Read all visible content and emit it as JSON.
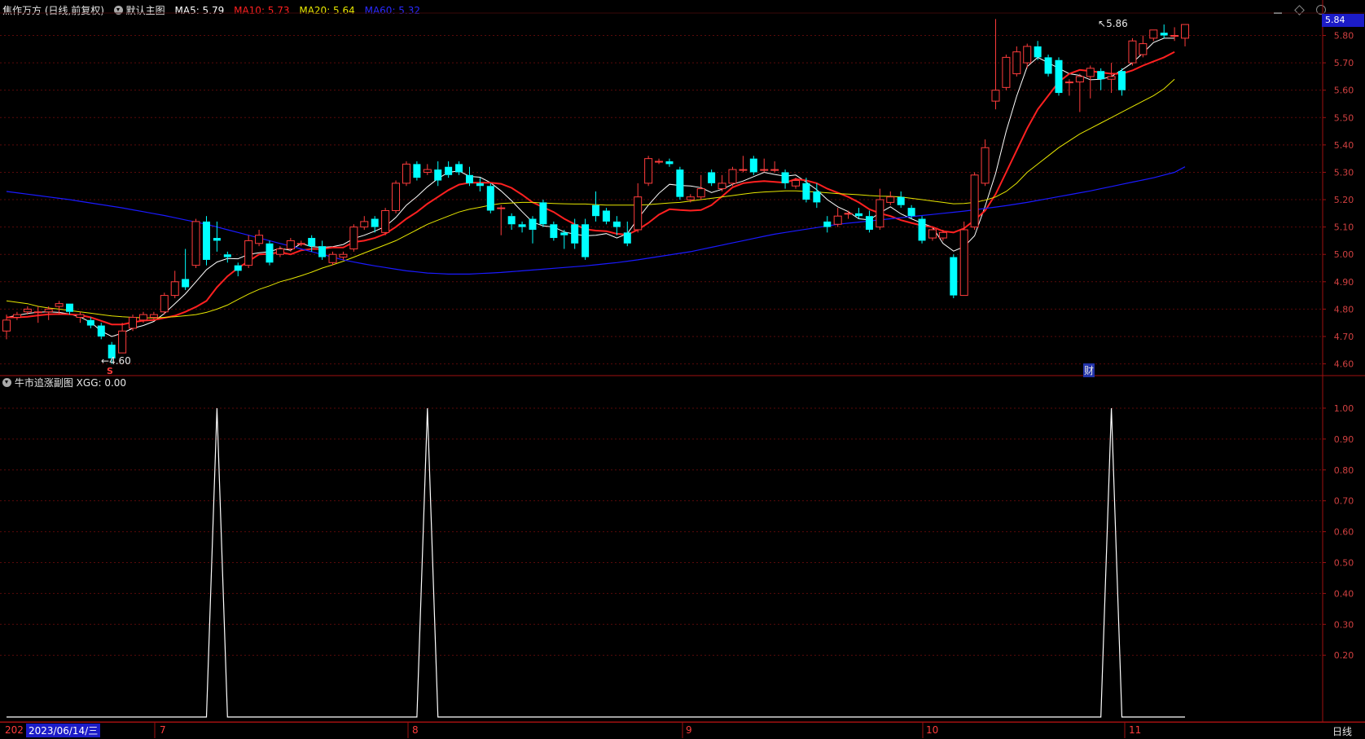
{
  "header": {
    "stock_title": "焦作万方 (日线,前复权)",
    "indicator_name": "默认主图",
    "ma5": "MA5: 5.79",
    "ma10": "MA10: 5.73",
    "ma20": "MA20: 5.64",
    "ma60": "MA60: 5.32"
  },
  "sub_header": {
    "indicator_name": "牛市追涨副图",
    "value": "XGG: 0.00"
  },
  "colors": {
    "up": "#ff3c3c",
    "down": "#00ffff",
    "ma5": "#ffffff",
    "ma10": "#ff2020",
    "ma20": "#e6e600",
    "ma60": "#1a1aff",
    "axis": "#a01010",
    "price_tag_bg": "#1c1cc8"
  },
  "current_price_tag": "5.84",
  "annotations": {
    "high_label": "5.86",
    "low_label": "4.60",
    "s_marker": "S",
    "cai_marker": "财"
  },
  "bottom_bar": {
    "year_clip": "202",
    "date_label": "2023/06/14/三",
    "months": [
      "7",
      "8",
      "9",
      "10",
      "11"
    ],
    "period_button": "日线"
  },
  "chart_data": [
    {
      "type": "candlestick",
      "ylim": [
        4.56,
        5.87
      ],
      "y_ticks": [
        "5.80",
        "5.70",
        "5.60",
        "5.50",
        "5.40",
        "5.30",
        "5.20",
        "5.10",
        "5.00",
        "4.90",
        "4.80",
        "4.70",
        "4.60"
      ],
      "candles": [
        [
          4.72,
          4.76,
          4.69,
          4.78
        ],
        [
          4.77,
          4.78,
          4.76,
          4.79
        ],
        [
          4.79,
          4.8,
          4.78,
          4.81
        ],
        [
          4.79,
          4.79,
          4.75,
          4.81
        ],
        [
          4.79,
          4.8,
          4.76,
          4.81
        ],
        [
          4.81,
          4.82,
          4.78,
          4.83
        ],
        [
          4.82,
          4.79,
          4.78,
          4.82
        ],
        [
          4.77,
          4.78,
          4.75,
          4.79
        ],
        [
          4.76,
          4.74,
          4.73,
          4.77
        ],
        [
          4.74,
          4.7,
          4.69,
          4.75
        ],
        [
          4.67,
          4.62,
          4.6,
          4.68
        ],
        [
          4.64,
          4.72,
          4.64,
          4.75
        ],
        [
          4.73,
          4.77,
          4.72,
          4.78
        ],
        [
          4.76,
          4.78,
          4.75,
          4.79
        ],
        [
          4.77,
          4.78,
          4.76,
          4.79
        ],
        [
          4.79,
          4.85,
          4.78,
          4.86
        ],
        [
          4.85,
          4.9,
          4.84,
          4.94
        ],
        [
          4.91,
          4.88,
          4.87,
          5.02
        ],
        [
          4.96,
          5.12,
          4.95,
          5.13
        ],
        [
          5.12,
          4.98,
          4.96,
          5.14
        ],
        [
          5.06,
          5.05,
          5.01,
          5.12
        ],
        [
          5.0,
          4.99,
          4.97,
          5.01
        ],
        [
          4.96,
          4.94,
          4.92,
          4.97
        ],
        [
          4.96,
          5.05,
          4.95,
          5.07
        ],
        [
          5.04,
          5.07,
          5.03,
          5.09
        ],
        [
          5.04,
          4.97,
          4.96,
          5.05
        ],
        [
          5.0,
          5.02,
          4.99,
          5.03
        ],
        [
          5.02,
          5.05,
          5.01,
          5.06
        ],
        [
          5.04,
          5.04,
          5.03,
          5.05
        ],
        [
          5.06,
          5.03,
          5.01,
          5.07
        ],
        [
          5.03,
          4.99,
          4.98,
          5.05
        ],
        [
          4.97,
          5.0,
          4.96,
          5.01
        ],
        [
          4.99,
          5.0,
          4.98,
          5.01
        ],
        [
          5.02,
          5.1,
          5.01,
          5.11
        ],
        [
          5.1,
          5.12,
          5.09,
          5.14
        ],
        [
          5.13,
          5.1,
          5.08,
          5.14
        ],
        [
          5.08,
          5.16,
          5.07,
          5.17
        ],
        [
          5.16,
          5.26,
          5.15,
          5.27
        ],
        [
          5.26,
          5.33,
          5.25,
          5.34
        ],
        [
          5.33,
          5.28,
          5.27,
          5.34
        ],
        [
          5.3,
          5.31,
          5.29,
          5.33
        ],
        [
          5.31,
          5.27,
          5.25,
          5.34
        ],
        [
          5.32,
          5.29,
          5.28,
          5.34
        ],
        [
          5.33,
          5.3,
          5.29,
          5.34
        ],
        [
          5.29,
          5.26,
          5.25,
          5.32
        ],
        [
          5.26,
          5.25,
          5.23,
          5.28
        ],
        [
          5.25,
          5.16,
          5.15,
          5.26
        ],
        [
          5.17,
          5.17,
          5.07,
          5.18
        ],
        [
          5.14,
          5.11,
          5.09,
          5.15
        ],
        [
          5.11,
          5.1,
          5.08,
          5.12
        ],
        [
          5.13,
          5.09,
          5.04,
          5.14
        ],
        [
          5.19,
          5.11,
          5.1,
          5.2
        ],
        [
          5.11,
          5.06,
          5.05,
          5.12
        ],
        [
          5.08,
          5.07,
          5.02,
          5.09
        ],
        [
          5.11,
          5.04,
          5.02,
          5.13
        ],
        [
          5.11,
          4.99,
          4.98,
          5.13
        ],
        [
          5.18,
          5.14,
          5.12,
          5.23
        ],
        [
          5.16,
          5.12,
          5.11,
          5.17
        ],
        [
          5.12,
          5.1,
          5.07,
          5.14
        ],
        [
          5.08,
          5.04,
          5.03,
          5.12
        ],
        [
          5.09,
          5.21,
          5.08,
          5.26
        ],
        [
          5.26,
          5.35,
          5.25,
          5.36
        ],
        [
          5.34,
          5.34,
          5.33,
          5.35
        ],
        [
          5.34,
          5.33,
          5.32,
          5.35
        ],
        [
          5.31,
          5.21,
          5.2,
          5.32
        ],
        [
          5.2,
          5.21,
          5.19,
          5.22
        ],
        [
          5.21,
          5.24,
          5.2,
          5.29
        ],
        [
          5.3,
          5.26,
          5.25,
          5.31
        ],
        [
          5.24,
          5.26,
          5.23,
          5.29
        ],
        [
          5.26,
          5.31,
          5.25,
          5.32
        ],
        [
          5.31,
          5.31,
          5.3,
          5.36
        ],
        [
          5.35,
          5.3,
          5.29,
          5.36
        ],
        [
          5.31,
          5.31,
          5.3,
          5.35
        ],
        [
          5.31,
          5.31,
          5.3,
          5.34
        ],
        [
          5.3,
          5.26,
          5.24,
          5.31
        ],
        [
          5.25,
          5.27,
          5.24,
          5.28
        ],
        [
          5.26,
          5.2,
          5.19,
          5.28
        ],
        [
          5.23,
          5.19,
          5.17,
          5.26
        ],
        [
          5.12,
          5.1,
          5.08,
          5.14
        ],
        [
          5.11,
          5.14,
          5.1,
          5.17
        ],
        [
          5.15,
          5.15,
          5.13,
          5.16
        ],
        [
          5.15,
          5.14,
          5.13,
          5.17
        ],
        [
          5.14,
          5.09,
          5.08,
          5.16
        ],
        [
          5.1,
          5.2,
          5.09,
          5.24
        ],
        [
          5.19,
          5.21,
          5.18,
          5.23
        ],
        [
          5.21,
          5.18,
          5.17,
          5.23
        ],
        [
          5.17,
          5.14,
          5.13,
          5.18
        ],
        [
          5.13,
          5.05,
          5.04,
          5.14
        ],
        [
          5.06,
          5.09,
          5.05,
          5.1
        ],
        [
          5.06,
          5.08,
          5.05,
          5.09
        ],
        [
          4.99,
          4.85,
          4.84,
          5.0
        ],
        [
          4.85,
          5.09,
          4.85,
          5.12
        ],
        [
          5.1,
          5.29,
          5.09,
          5.3
        ],
        [
          5.26,
          5.39,
          5.25,
          5.42
        ],
        [
          5.56,
          5.6,
          5.53,
          5.86
        ],
        [
          5.61,
          5.72,
          5.6,
          5.73
        ],
        [
          5.66,
          5.74,
          5.65,
          5.76
        ],
        [
          5.7,
          5.76,
          5.68,
          5.77
        ],
        [
          5.76,
          5.72,
          5.71,
          5.78
        ],
        [
          5.72,
          5.66,
          5.65,
          5.73
        ],
        [
          5.71,
          5.59,
          5.58,
          5.72
        ],
        [
          5.63,
          5.63,
          5.58,
          5.64
        ],
        [
          5.63,
          5.65,
          5.52,
          5.66
        ],
        [
          5.65,
          5.68,
          5.57,
          5.69
        ],
        [
          5.67,
          5.64,
          5.6,
          5.68
        ],
        [
          5.64,
          5.65,
          5.59,
          5.7
        ],
        [
          5.67,
          5.6,
          5.58,
          5.68
        ],
        [
          5.7,
          5.78,
          5.69,
          5.79
        ],
        [
          5.73,
          5.77,
          5.72,
          5.8
        ],
        [
          5.79,
          5.82,
          5.78,
          5.82
        ],
        [
          5.81,
          5.8,
          5.79,
          5.84
        ],
        [
          5.8,
          5.8,
          5.78,
          5.83
        ],
        [
          5.79,
          5.84,
          5.76,
          5.84
        ]
      ],
      "ma_series": [
        {
          "name": "MA5",
          "values": [
            4.77,
            4.777,
            4.784,
            4.789,
            4.79,
            4.788,
            4.782,
            4.771,
            4.752,
            4.72,
            4.7,
            4.712,
            4.73,
            4.74,
            4.755,
            4.784,
            4.82,
            4.856,
            4.9,
            4.944,
            4.972,
            4.985,
            4.984,
            5.0,
            5.006,
            5.01,
            5.022,
            5.015,
            5.04,
            5.028,
            5.026,
            5.028,
            5.036,
            5.058,
            5.07,
            5.085,
            5.102,
            5.135,
            5.18,
            5.211,
            5.247,
            5.277,
            5.3,
            5.305,
            5.285,
            5.282,
            5.262,
            5.232,
            5.196,
            5.156,
            5.118,
            5.104,
            5.1,
            5.082,
            5.074,
            5.068,
            5.07,
            5.076,
            5.06,
            5.076,
            5.13,
            5.18,
            5.223,
            5.256,
            5.252,
            5.25,
            5.244,
            5.226,
            5.238,
            5.256,
            5.268,
            5.284,
            5.3,
            5.292,
            5.286,
            5.29,
            5.264,
            5.236,
            5.2,
            5.174,
            5.156,
            5.13,
            5.126,
            5.152,
            5.174,
            5.148,
            5.13,
            5.114,
            5.1,
            5.04,
            5.012,
            5.028,
            5.068,
            5.176,
            5.296,
            5.45,
            5.578,
            5.686,
            5.72,
            5.7,
            5.68,
            5.66,
            5.654,
            5.638,
            5.64,
            5.65,
            5.674,
            5.7,
            5.736,
            5.774,
            5.79,
            5.79
          ]
        },
        {
          "name": "MA10",
          "values": [
            4.77,
            4.77,
            4.772,
            4.777,
            4.781,
            4.782,
            4.781,
            4.778,
            4.77,
            4.757,
            4.744,
            4.744,
            4.752,
            4.758,
            4.76,
            4.768,
            4.776,
            4.79,
            4.808,
            4.83,
            4.88,
            4.92,
            4.95,
            4.975,
            5.0,
            5.002,
            5.008,
            5.0,
            5.015,
            5.02,
            5.02,
            5.025,
            5.025,
            5.045,
            5.05,
            5.06,
            5.075,
            5.1,
            5.13,
            5.155,
            5.185,
            5.21,
            5.235,
            5.255,
            5.262,
            5.262,
            5.262,
            5.258,
            5.243,
            5.218,
            5.19,
            5.172,
            5.155,
            5.13,
            5.11,
            5.092,
            5.087,
            5.085,
            5.075,
            5.072,
            5.09,
            5.115,
            5.145,
            5.165,
            5.162,
            5.16,
            5.162,
            5.18,
            5.212,
            5.245,
            5.26,
            5.265,
            5.268,
            5.265,
            5.262,
            5.275,
            5.27,
            5.26,
            5.24,
            5.225,
            5.21,
            5.19,
            5.165,
            5.15,
            5.14,
            5.125,
            5.115,
            5.105,
            5.1,
            5.085,
            5.08,
            5.095,
            5.125,
            5.16,
            5.22,
            5.3,
            5.38,
            5.46,
            5.53,
            5.58,
            5.63,
            5.66,
            5.674,
            5.67,
            5.665,
            5.66,
            5.66,
            5.672,
            5.69,
            5.705,
            5.72,
            5.74
          ]
        },
        {
          "name": "MA20",
          "values": [
            4.83,
            4.825,
            4.82,
            4.81,
            4.804,
            4.8,
            4.795,
            4.79,
            4.785,
            4.78,
            4.775,
            4.772,
            4.77,
            4.768,
            4.768,
            4.77,
            4.772,
            4.776,
            4.78,
            4.788,
            4.8,
            4.815,
            4.835,
            4.855,
            4.872,
            4.885,
            4.9,
            4.91,
            4.922,
            4.935,
            4.95,
            4.962,
            4.975,
            4.99,
            5.005,
            5.02,
            5.035,
            5.05,
            5.07,
            5.09,
            5.11,
            5.125,
            5.14,
            5.155,
            5.165,
            5.172,
            5.18,
            5.186,
            5.188,
            5.19,
            5.19,
            5.188,
            5.186,
            5.185,
            5.184,
            5.184,
            5.182,
            5.18,
            5.18,
            5.18,
            5.18,
            5.182,
            5.185,
            5.188,
            5.19,
            5.195,
            5.2,
            5.205,
            5.21,
            5.215,
            5.22,
            5.225,
            5.228,
            5.23,
            5.232,
            5.232,
            5.23,
            5.228,
            5.225,
            5.222,
            5.22,
            5.218,
            5.215,
            5.213,
            5.212,
            5.21,
            5.205,
            5.2,
            5.195,
            5.19,
            5.185,
            5.186,
            5.19,
            5.198,
            5.21,
            5.23,
            5.26,
            5.3,
            5.33,
            5.36,
            5.39,
            5.415,
            5.44,
            5.46,
            5.48,
            5.5,
            5.52,
            5.54,
            5.56,
            5.58,
            5.605,
            5.64
          ]
        },
        {
          "name": "MA60",
          "values": [
            5.23,
            5.225,
            5.22,
            5.215,
            5.21,
            5.205,
            5.2,
            5.194,
            5.188,
            5.182,
            5.176,
            5.17,
            5.163,
            5.156,
            5.149,
            5.142,
            5.134,
            5.126,
            5.118,
            5.11,
            5.1,
            5.09,
            5.08,
            5.07,
            5.06,
            5.05,
            5.04,
            5.03,
            5.02,
            5.01,
            5.0,
            4.99,
            4.98,
            4.972,
            4.965,
            4.958,
            4.952,
            4.946,
            4.94,
            4.936,
            4.932,
            4.93,
            4.928,
            4.928,
            4.928,
            4.93,
            4.932,
            4.934,
            4.937,
            4.94,
            4.943,
            4.946,
            4.949,
            4.952,
            4.955,
            4.958,
            4.962,
            4.966,
            4.97,
            4.975,
            4.98,
            4.986,
            4.992,
            4.998,
            5.004,
            5.01,
            5.018,
            5.026,
            5.034,
            5.042,
            5.05,
            5.058,
            5.066,
            5.074,
            5.08,
            5.086,
            5.092,
            5.098,
            5.104,
            5.11,
            5.114,
            5.118,
            5.122,
            5.126,
            5.13,
            5.134,
            5.138,
            5.142,
            5.146,
            5.15,
            5.154,
            5.158,
            5.163,
            5.168,
            5.173,
            5.178,
            5.184,
            5.19,
            5.197,
            5.204,
            5.211,
            5.218,
            5.225,
            5.232,
            5.24,
            5.248,
            5.256,
            5.264,
            5.272,
            5.28,
            5.29,
            5.3,
            5.32
          ]
        }
      ]
    },
    {
      "type": "line",
      "name": "XGG",
      "ylim": [
        0,
        1.05
      ],
      "y_ticks": [
        "1.00",
        "0.90",
        "0.80",
        "0.70",
        "0.60",
        "0.50",
        "0.40",
        "0.30",
        "0.20"
      ],
      "spike_indices": [
        20,
        40,
        105
      ]
    }
  ]
}
